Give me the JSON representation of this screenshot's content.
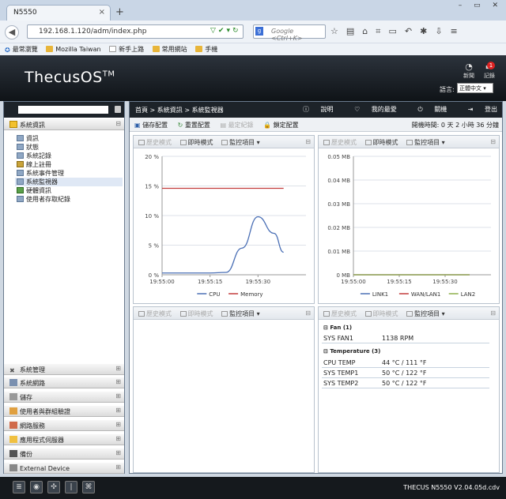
{
  "browser": {
    "tab_title": "N5550",
    "tab_close": "×",
    "new_tab": "+",
    "window_controls": "– ▭ ✕",
    "url": "192.168.1.120/adm/index.php",
    "search_placeholder": "Google <Ctrl+K>",
    "search_engine_letter": "g",
    "bookmarks": [
      "最常瀏覽",
      "Mozilla Taiwan",
      "新手上路",
      "常用網站",
      "手機"
    ],
    "icons": [
      "star-icon",
      "bookmarks-icon",
      "home-icon",
      "crop-icon",
      "comment-icon",
      "undo-icon",
      "addon-icon",
      "download-icon",
      "menu-icon"
    ]
  },
  "header": {
    "logo": "ThecusOS",
    "logo_tm": "TM",
    "news_label": "新聞",
    "log_label": "記錄",
    "log_badge": "1",
    "language_label": "語言:",
    "language_value": "正體中文"
  },
  "sidebar": {
    "system_info": "系統資訊",
    "tree": [
      "資訊",
      "狀態",
      "系統記錄",
      "線上註冊",
      "系統事件管理",
      "系統監視器",
      "硬體資訊",
      "使用者存取紀錄"
    ],
    "selected_index": 5,
    "sections": [
      "系統管理",
      "系統網路",
      "儲存",
      "使用者與群組驗證",
      "網路服務",
      "應用程式伺服器",
      "備份",
      "External Device"
    ]
  },
  "main": {
    "breadcrumb": "首頁 > 系統資訊 > 系統監視器",
    "top_actions": [
      "說明",
      "我的最愛",
      "關機",
      "登出"
    ],
    "toolbar": {
      "save": "儲存配置",
      "reset": "重置配置",
      "fixed_record": "最定紀錄",
      "lock": "鎖定配置",
      "uptime_label": "開機時間:",
      "uptime_value": "0 天 2 小時 36 分鐘"
    },
    "panel_header": {
      "history": "歷史模式",
      "realtime": "即時模式",
      "monitor": "監控項目"
    },
    "sensors": {
      "fan_group": "Fan (1)",
      "fan_rows": [
        {
          "name": "SYS FAN1",
          "value": "1138 RPM"
        }
      ],
      "temp_group": "Temperature (3)",
      "temp_rows": [
        {
          "name": "CPU TEMP",
          "value": "44 °C / 111 °F"
        },
        {
          "name": "SYS TEMP1",
          "value": "50 °C / 122 °F"
        },
        {
          "name": "SYS TEMP2",
          "value": "50 °C / 122 °F"
        }
      ]
    }
  },
  "chart_data": [
    {
      "type": "line",
      "x": [
        "19:55:00",
        "19:55:05",
        "19:55:10",
        "19:55:15",
        "19:55:20",
        "19:55:25",
        "19:55:30",
        "19:55:35",
        "19:55:38"
      ],
      "yticks": [
        "0 %",
        "5 %",
        "10 %",
        "15 %",
        "20 %"
      ],
      "ylim": [
        0,
        20
      ],
      "xticks": [
        "19:55:00",
        "19:55:15",
        "19:55:30"
      ],
      "series": [
        {
          "name": "CPU",
          "color": "#4a6fb5",
          "values": [
            0.3,
            0.3,
            0.3,
            0.3,
            0.4,
            4.5,
            9.8,
            7.0,
            3.8
          ]
        },
        {
          "name": "Memory",
          "color": "#c23b3b",
          "values": [
            14.6,
            14.6,
            14.6,
            14.6,
            14.6,
            14.6,
            14.6,
            14.6,
            14.6
          ]
        }
      ]
    },
    {
      "type": "line",
      "x": [
        "19:55:00",
        "19:55:15",
        "19:55:30",
        "19:55:38"
      ],
      "yticks": [
        "0 MB",
        "0.01 MB",
        "0.02 MB",
        "0.03 MB",
        "0.04 MB",
        "0.05 MB"
      ],
      "ylim": [
        0,
        0.05
      ],
      "xticks": [
        "19:55:00",
        "19:55:15",
        "19:55:30"
      ],
      "series": [
        {
          "name": "LINK1",
          "color": "#4a6fb5",
          "values": [
            0,
            0,
            0,
            0
          ]
        },
        {
          "name": "WAN/LAN1",
          "color": "#c23b3b",
          "values": [
            0,
            0,
            0,
            0
          ]
        },
        {
          "name": "LAN2",
          "color": "#8db04a",
          "values": [
            0,
            0,
            0,
            0
          ]
        }
      ]
    }
  ],
  "status": {
    "version": "THECUS N5550 V2.04.05d.cdv"
  }
}
